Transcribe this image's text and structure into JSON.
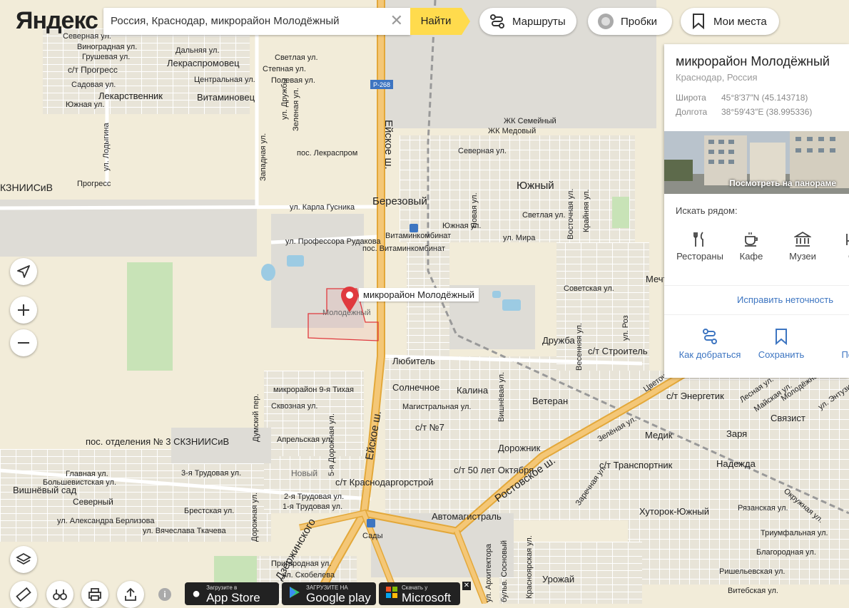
{
  "header": {
    "logo_text": "Яндекс",
    "search_value": "Россия, Краснодар, микрорайон Молодёжный",
    "find_label": "Найти",
    "routes_label": "Маршруты",
    "traffic_label": "Пробки",
    "places_label": "Мои места"
  },
  "marker": {
    "label": "микрорайон Молодёжный",
    "color": "#e0393e"
  },
  "panel": {
    "title": "микрорайон Молодёжный",
    "subtitle": "Краснодар, Россия",
    "latitude_key": "Широта",
    "latitude_value": "45°8′37″N (45.143718)",
    "longitude_key": "Долгота",
    "longitude_value": "38°59′43″E (38.995336)",
    "panorama_label": "Посмотреть на панораме",
    "nearby_title": "Искать рядом:",
    "nearby": [
      {
        "label": "Рестораны",
        "icon": "fork-knife-icon"
      },
      {
        "label": "Кафе",
        "icon": "coffee-cup-icon"
      },
      {
        "label": "Музеи",
        "icon": "museum-icon"
      },
      {
        "label": "От",
        "icon": "hotel-icon"
      }
    ],
    "fix_label": "Исправить неточность",
    "actions": [
      {
        "label": "Как добраться",
        "icon": "route-icon"
      },
      {
        "label": "Сохранить",
        "icon": "bookmark-icon"
      },
      {
        "label": "Поде",
        "icon": "share-icon"
      }
    ]
  },
  "stores": [
    {
      "small": "Загрузите в",
      "big": "App Store"
    },
    {
      "small": "ЗАГРУЗИТЕ НА",
      "big": "Google play"
    },
    {
      "small": "Скачать у",
      "big": "Microsoft"
    }
  ],
  "info_label": "i",
  "close_label": "✕",
  "road_shields": [
    "Р-268"
  ],
  "map_labels": {
    "districts": [
      "Лекраспромовец",
      "Лекарственник",
      "Витаминовец",
      "КЗНИИСиВ",
      "Березовый",
      "Южный",
      "Дружба",
      "Любитель",
      "Солнечное",
      "Калина",
      "Ветеран",
      "с/т №7",
      "Дорожник",
      "с/т 50 лет Октября",
      "с/т Краснодаргорстрой",
      "Автомагистраль",
      "Вишнёвый сад",
      "пос. отделения № 3 СКЗНИИСиВ",
      "Медик",
      "Заря",
      "Связист",
      "Надежда",
      "с/т Транспортник",
      "Хуторок-Южный",
      "Урожай",
      "с/т Энергетик",
      "с/т Строитель",
      "Мечт",
      "с/т Прогресс",
      "Прогресс",
      "Садовая ул.",
      "Северный",
      "Новый",
      "Молодёжный",
      "Сады"
    ],
    "small": [
      "Северная ул.",
      "Виноградная ул.",
      "Грушевая ул.",
      "Южная ул.",
      "Дальняя ул.",
      "Светлая ул.",
      "Полевая ул.",
      "Центральная ул.",
      "Степная ул.",
      "ул. Лодыгина",
      "Западная ул.",
      "ул. Дружбы",
      "Зеленая ул.",
      "пос. Лекраспром",
      "ул. Карла Гусника",
      "ул. Профессора Рудакова",
      "пос. Витаминкомбинат",
      "Витаминкомбинат",
      "ЖК Семейный",
      "ЖК Медовый",
      "Северная ул.",
      "Светлая ул.",
      "Южная ул.",
      "ул. Мира",
      "Новая ул.",
      "Восточная ул.",
      "Крайняя ул.",
      "Советская ул.",
      "микрорайон 9-я Тихая",
      "Сквозная ул.",
      "Апрельская ул.",
      "5-я Дорожная ул.",
      "Главная ул.",
      "3-я Трудовая ул.",
      "Большевистская ул.",
      "2-я Трудовая ул.",
      "1-я Трудовая ул.",
      "Брестская ул.",
      "ул. Александра Берлизова",
      "ул. Вячеслава Ткачева",
      "Дорожная ул.",
      "Пригородная ул.",
      "ул. Скобелева",
      "Магистральная ул.",
      "Вишнёвая ул.",
      "Зелёная ул.",
      "Заречная ул.",
      "Рязанская ул.",
      "Триумфальная ул.",
      "Ришельевская ул.",
      "Витебская ул.",
      "Благородная ул.",
      "Окружная ул.",
      "Лесная ул.",
      "Майская ул.",
      "Молодёжная ул.",
      "ул. Энтузиастов",
      "Красноярская ул.",
      "бульв. Сосновый",
      "ул. Архитектора",
      "Весенняя ул.",
      "Думский пер.",
      "ул. Роз",
      "Цветочная ул."
    ],
    "highways": [
      "Ейское ш.",
      "Ростовское ш.",
      "ул. Дзержинского"
    ]
  },
  "colors": {
    "map_bg": "#f2ecd9",
    "road": "#f4c777",
    "road_edge": "#e3a83a",
    "block": "#dcdad2",
    "green": "#c8e3b7",
    "water": "#9ccbe3",
    "accent": "#ffdb4d"
  }
}
